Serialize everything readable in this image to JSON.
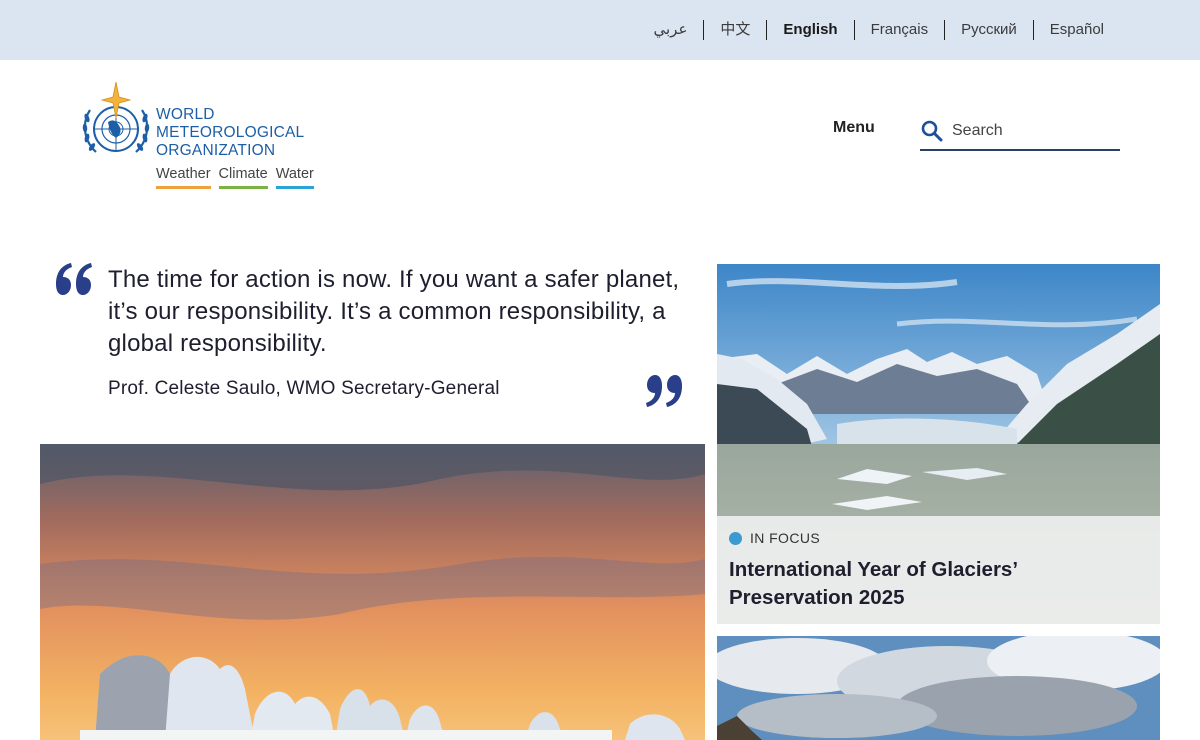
{
  "languages": [
    {
      "label": "عربي",
      "active": false
    },
    {
      "label": "中文",
      "active": false
    },
    {
      "label": "English",
      "active": true
    },
    {
      "label": "Français",
      "active": false
    },
    {
      "label": "Русский",
      "active": false
    },
    {
      "label": "Español",
      "active": false
    }
  ],
  "logo": {
    "line1": "WORLD",
    "line2": "METEOROLOGICAL",
    "line3": "ORGANIZATION",
    "tags": [
      "Weather",
      "Climate",
      "Water"
    ],
    "icon": "un-emblem-icon"
  },
  "header": {
    "menu_label": "Menu",
    "search_placeholder": "Search",
    "search_icon": "search-icon"
  },
  "quote": {
    "text": "The time for action is now. If you want a safer planet, it’s our responsibility. It’s a common responsibility, a global responsibility.",
    "author": "Prof. Celeste Saulo, WMO Secretary-General",
    "open_icon": "open-quote-icon",
    "close_icon": "close-quote-icon"
  },
  "cards": [
    {
      "kicker": "IN FOCUS",
      "title": "International Year of Glaciers’ Preservation 2025",
      "image": "glacier-fjord-image"
    },
    {
      "image": "cloudy-sky-image"
    }
  ],
  "hero": {
    "image": "snowy-trees-sunset-image"
  },
  "colors": {
    "lang_bar": "#dbe4f1",
    "brand_blue": "#1d5fa6",
    "quote_navy": "#2a3f8a",
    "weather": "#f0a03c",
    "climate": "#7bb241",
    "water": "#2aa3d6",
    "kicker_dot": "#3a9bd0"
  }
}
